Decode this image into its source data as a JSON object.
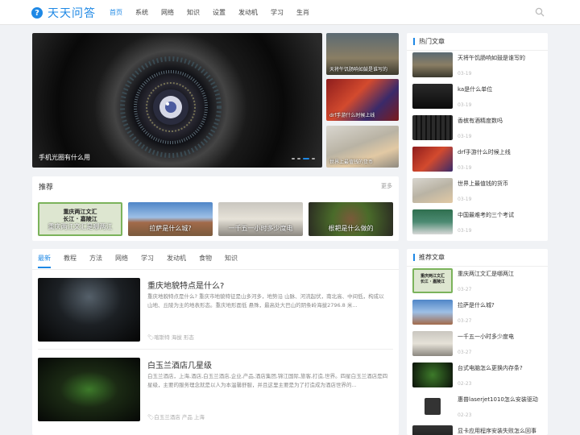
{
  "site": {
    "logo_mark": "?",
    "name": "天天问答"
  },
  "nav": [
    "首页",
    "系统",
    "网络",
    "知识",
    "设置",
    "发动机",
    "学习",
    "生肖"
  ],
  "slider": {
    "caption": "手机光圈有什么用",
    "active_dot": 3,
    "dot_count": 4
  },
  "side_thumbs": [
    "天将午饥肠响如鼓是谁写的",
    "drf手游什么时候上线",
    "世界上最值钱的货币"
  ],
  "recommend": {
    "title": "推荐",
    "more": "更多",
    "banner_text": [
      "重庆两江文汇",
      "长江 · 嘉陵江"
    ],
    "items": [
      "重庆两江文汇是哪两江",
      "拉萨是什么城?",
      "一千五一小时多少度电",
      "根耙是什么做的"
    ]
  },
  "tabs": [
    "最新",
    "教程",
    "方法",
    "网络",
    "学习",
    "发动机",
    "食物",
    "知识"
  ],
  "articles": [
    {
      "title": "重庆地貌特点是什么?",
      "summary": "重庆地貌特点是什么? 重庆市地貌特征是山多河多，地势沿 山脉、河流起伏，南北高、中间低，构成以 山地、丘陵为主的地表形态。重庆地形面低 悬殊，最高处大巴山的阴条岭海拔2796.8 米...",
      "tags": "喀斯特 海拔 形态"
    },
    {
      "title": "白玉兰酒店几星级",
      "summary": "白玉兰酒店，上海,酒店,白玉兰酒店,企业,产品,酒店集团,锦江国际,旅客,打造,世界。四星白玉兰酒店是四星级，主要的服务理念就是以人为本温馨舒服，并且这里主要是为了打造成为酒店世界的...",
      "tags": "白玉兰酒店 产品 上海"
    }
  ],
  "hot": {
    "title": "热门文章",
    "items": [
      {
        "title": "天将午饥肠响如鼓是谁写的",
        "date": "03-19"
      },
      {
        "title": "ka是什么单位",
        "date": "03-19"
      },
      {
        "title": "香槟有酒精度数吗",
        "date": "03-19"
      },
      {
        "title": "drf手游什么时候上线",
        "date": "03-19"
      },
      {
        "title": "世界上最值钱的货币",
        "date": "03-19"
      },
      {
        "title": "中国最难考的三个考试",
        "date": "03-19"
      }
    ]
  },
  "rec_side": {
    "title": "推荐文章",
    "banner_text": [
      "重庆两江文汇",
      "长江 · 嘉陵江"
    ],
    "items": [
      {
        "title": "重庆两江文汇是哪两江",
        "date": "03-27"
      },
      {
        "title": "拉萨是什么城?",
        "date": "03-27"
      },
      {
        "title": "一千五一小时多少度电",
        "date": "03-27"
      },
      {
        "title": "台式电脑怎么更换内存条?",
        "date": "02-23"
      },
      {
        "title": "惠普laserjet1010怎么安装驱动",
        "date": "02-23"
      },
      {
        "title": "显卡应用程序安装失败怎么回事",
        "date": ""
      }
    ]
  }
}
